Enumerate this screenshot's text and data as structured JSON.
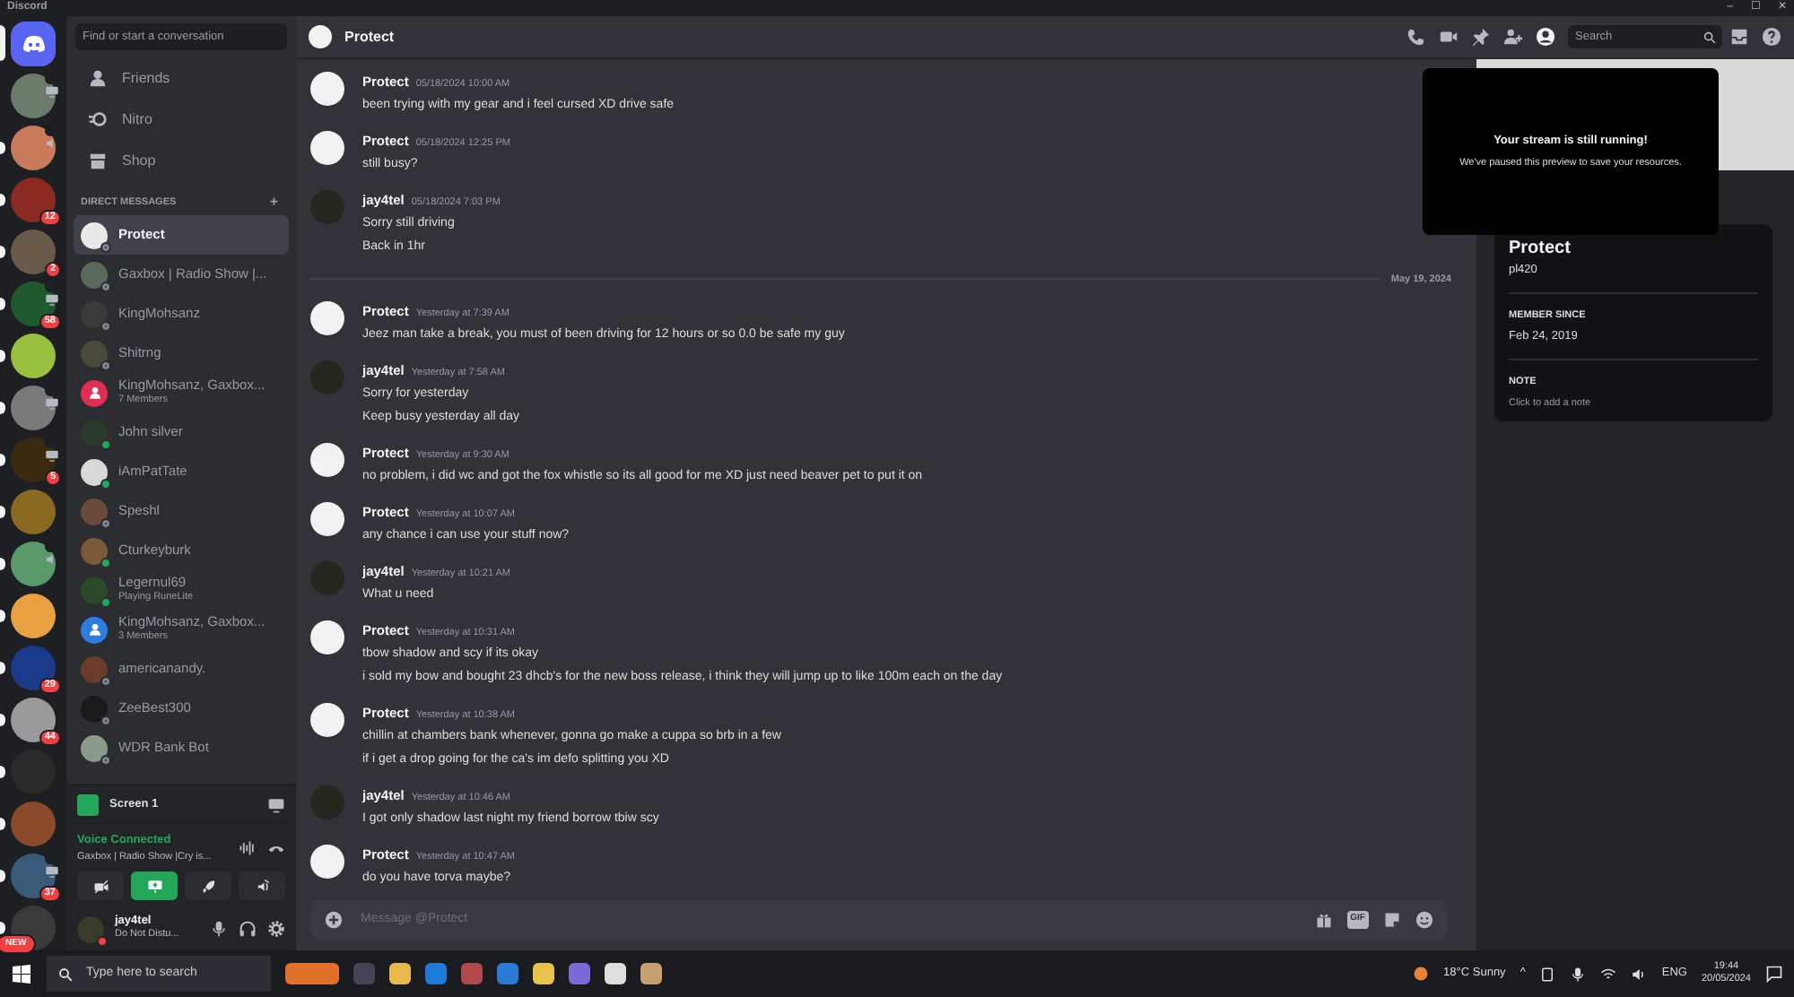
{
  "window": {
    "title": "Discord",
    "controls": [
      "–",
      "☐",
      "✕"
    ]
  },
  "servers": [
    {
      "selected": true,
      "kind": "home"
    },
    {
      "unread": false,
      "screen": true
    },
    {
      "unread": true,
      "voice": true
    },
    {
      "unread": true,
      "badge": "12"
    },
    {
      "unread": true,
      "badge": "2"
    },
    {
      "unread": true,
      "badge": "58",
      "screen": true
    },
    {
      "unread": true
    },
    {
      "unread": true,
      "screen": true
    },
    {
      "unread": true,
      "badge": "5",
      "screen": true
    },
    {
      "unread": true
    },
    {
      "unread": true,
      "voice": true
    },
    {
      "unread": true
    },
    {
      "unread": true,
      "badge": "29"
    },
    {
      "unread": true,
      "badge": "44"
    },
    {
      "unread": true
    },
    {
      "unread": true
    },
    {
      "unread": true,
      "badge": "37",
      "screen": true
    },
    {
      "unread": true,
      "badge": "NEW"
    }
  ],
  "sidebar": {
    "search_placeholder": "Find or start a conversation",
    "nav": [
      {
        "label": "Friends",
        "kind": "friends"
      },
      {
        "label": "Nitro",
        "kind": "nitro"
      },
      {
        "label": "Shop",
        "kind": "shop"
      }
    ],
    "section_title": "DIRECT MESSAGES",
    "add": "+",
    "dms": [
      {
        "name": "Protect",
        "selected": true,
        "kind": "user",
        "online": false
      },
      {
        "name": "Gaxbox | Radio Show |...",
        "selected": false,
        "kind": "user",
        "online": false
      },
      {
        "name": "KingMohsanz",
        "selected": false,
        "kind": "user",
        "online": false
      },
      {
        "name": "Shitrng",
        "selected": false,
        "kind": "user",
        "online": false
      },
      {
        "name": "KingMohsanz, Gaxbox...",
        "subtitle": "7 Members",
        "selected": false,
        "kind": "group",
        "color": "#e12d4f"
      },
      {
        "name": "John silver",
        "selected": false,
        "kind": "user",
        "online": true
      },
      {
        "name": "iAmPatTate",
        "selected": false,
        "kind": "user",
        "online": true
      },
      {
        "name": "Speshl",
        "selected": false,
        "kind": "user",
        "online": false
      },
      {
        "name": "Cturkeyburk",
        "selected": false,
        "kind": "user",
        "online": true
      },
      {
        "name": "Legernul69",
        "subtitle": "Playing RuneLite",
        "selected": false,
        "kind": "user",
        "online": true
      },
      {
        "name": "KingMohsanz, Gaxbox...",
        "subtitle": "3 Members",
        "selected": false,
        "kind": "group",
        "color": "#2f7ce0"
      },
      {
        "name": "americanandy.",
        "selected": false,
        "kind": "user",
        "online": false
      },
      {
        "name": "ZeeBest300",
        "selected": false,
        "kind": "user",
        "online": false
      },
      {
        "name": "WDR Bank Bot",
        "selected": false,
        "kind": "user",
        "online": false
      }
    ],
    "stream": {
      "label": "Screen 1"
    },
    "voice": {
      "status": "Voice Connected",
      "channel": "Gaxbox | Radio Show |Cry is...",
      "buttons": [
        {
          "kind": "camera",
          "active": false
        },
        {
          "kind": "screen",
          "active": true
        },
        {
          "kind": "activity",
          "active": false
        },
        {
          "kind": "soundboard",
          "active": false
        }
      ]
    },
    "user": {
      "name": "jay4tel",
      "status_text": "Do Not Distu...",
      "do_not_disturb": true
    }
  },
  "chat": {
    "title": "Protect",
    "search_placeholder": "Search",
    "messages": [
      {
        "kind": "message",
        "self": false,
        "author": "Protect",
        "time": "05/18/2024 10:00 AM",
        "lines": [
          "been trying with my gear and i feel cursed XD drive safe"
        ]
      },
      {
        "kind": "message",
        "self": false,
        "author": "Protect",
        "time": "05/18/2024 12:25 PM",
        "lines": [
          "still busy?"
        ]
      },
      {
        "kind": "message",
        "self": true,
        "author": "jay4tel",
        "time": "05/18/2024 7:03 PM",
        "lines": [
          "Sorry still driving",
          "Back in 1hr"
        ]
      },
      {
        "kind": "divider",
        "label": "May 19, 2024"
      },
      {
        "kind": "message",
        "self": false,
        "author": "Protect",
        "time": "Yesterday at 7:39 AM",
        "lines": [
          "Jeez man take a break, you must of been driving for 12 hours or so 0.0 be safe my guy"
        ]
      },
      {
        "kind": "message",
        "self": true,
        "author": "jay4tel",
        "time": "Yesterday at 7:58 AM",
        "lines": [
          "Sorry for yesterday",
          "Keep busy yesterday all day"
        ]
      },
      {
        "kind": "message",
        "self": false,
        "author": "Protect",
        "time": "Yesterday at 9:30 AM",
        "lines": [
          "no problem, i did wc and got the fox whistle so its all good for me XD just need beaver pet to put it on"
        ]
      },
      {
        "kind": "message",
        "self": false,
        "author": "Protect",
        "time": "Yesterday at 10:07 AM",
        "lines": [
          "any chance i can use your stuff now?"
        ]
      },
      {
        "kind": "message",
        "self": true,
        "author": "jay4tel",
        "time": "Yesterday at 10:21 AM",
        "lines": [
          "What u need"
        ]
      },
      {
        "kind": "message",
        "self": false,
        "author": "Protect",
        "time": "Yesterday at 10:31 AM",
        "lines": [
          "tbow shadow and scy if its okay",
          "i sold my bow and bought 23 dhcb's for the new boss release, i think they will jump up to like 100m each on the day"
        ]
      },
      {
        "kind": "message",
        "self": false,
        "author": "Protect",
        "time": "Yesterday at 10:38 AM",
        "lines": [
          "chillin at chambers bank whenever, gonna go make a cuppa so brb in a few",
          "if i get a drop going for the ca's im defo splitting you XD"
        ]
      },
      {
        "kind": "message",
        "self": true,
        "author": "jay4tel",
        "time": "Yesterday at 10:46 AM",
        "lines": [
          "I got only shadow last night my friend borrow tbiw scy"
        ]
      },
      {
        "kind": "message",
        "self": false,
        "author": "Protect",
        "time": "Yesterday at 10:47 AM",
        "lines": [
          "do you have torva maybe?"
        ]
      }
    ],
    "composer": {
      "placeholder": "Message @Protect",
      "gif_label": "GIF"
    }
  },
  "profile": {
    "display_name": "Protect",
    "username": "pl420",
    "member_since_label": "MEMBER SINCE",
    "member_since": "Feb 24, 2019",
    "note_label": "NOTE",
    "note_placeholder": "Click to add a note"
  },
  "stream_notice": {
    "title": "Your stream is still running!",
    "text": "We've paused this preview to save your resources."
  },
  "taskbar": {
    "search_placeholder": "Type here to search",
    "weather": "18°C  Sunny",
    "chevron": "^",
    "language": "ENG",
    "time": "19:44",
    "date": "20/05/2024"
  }
}
